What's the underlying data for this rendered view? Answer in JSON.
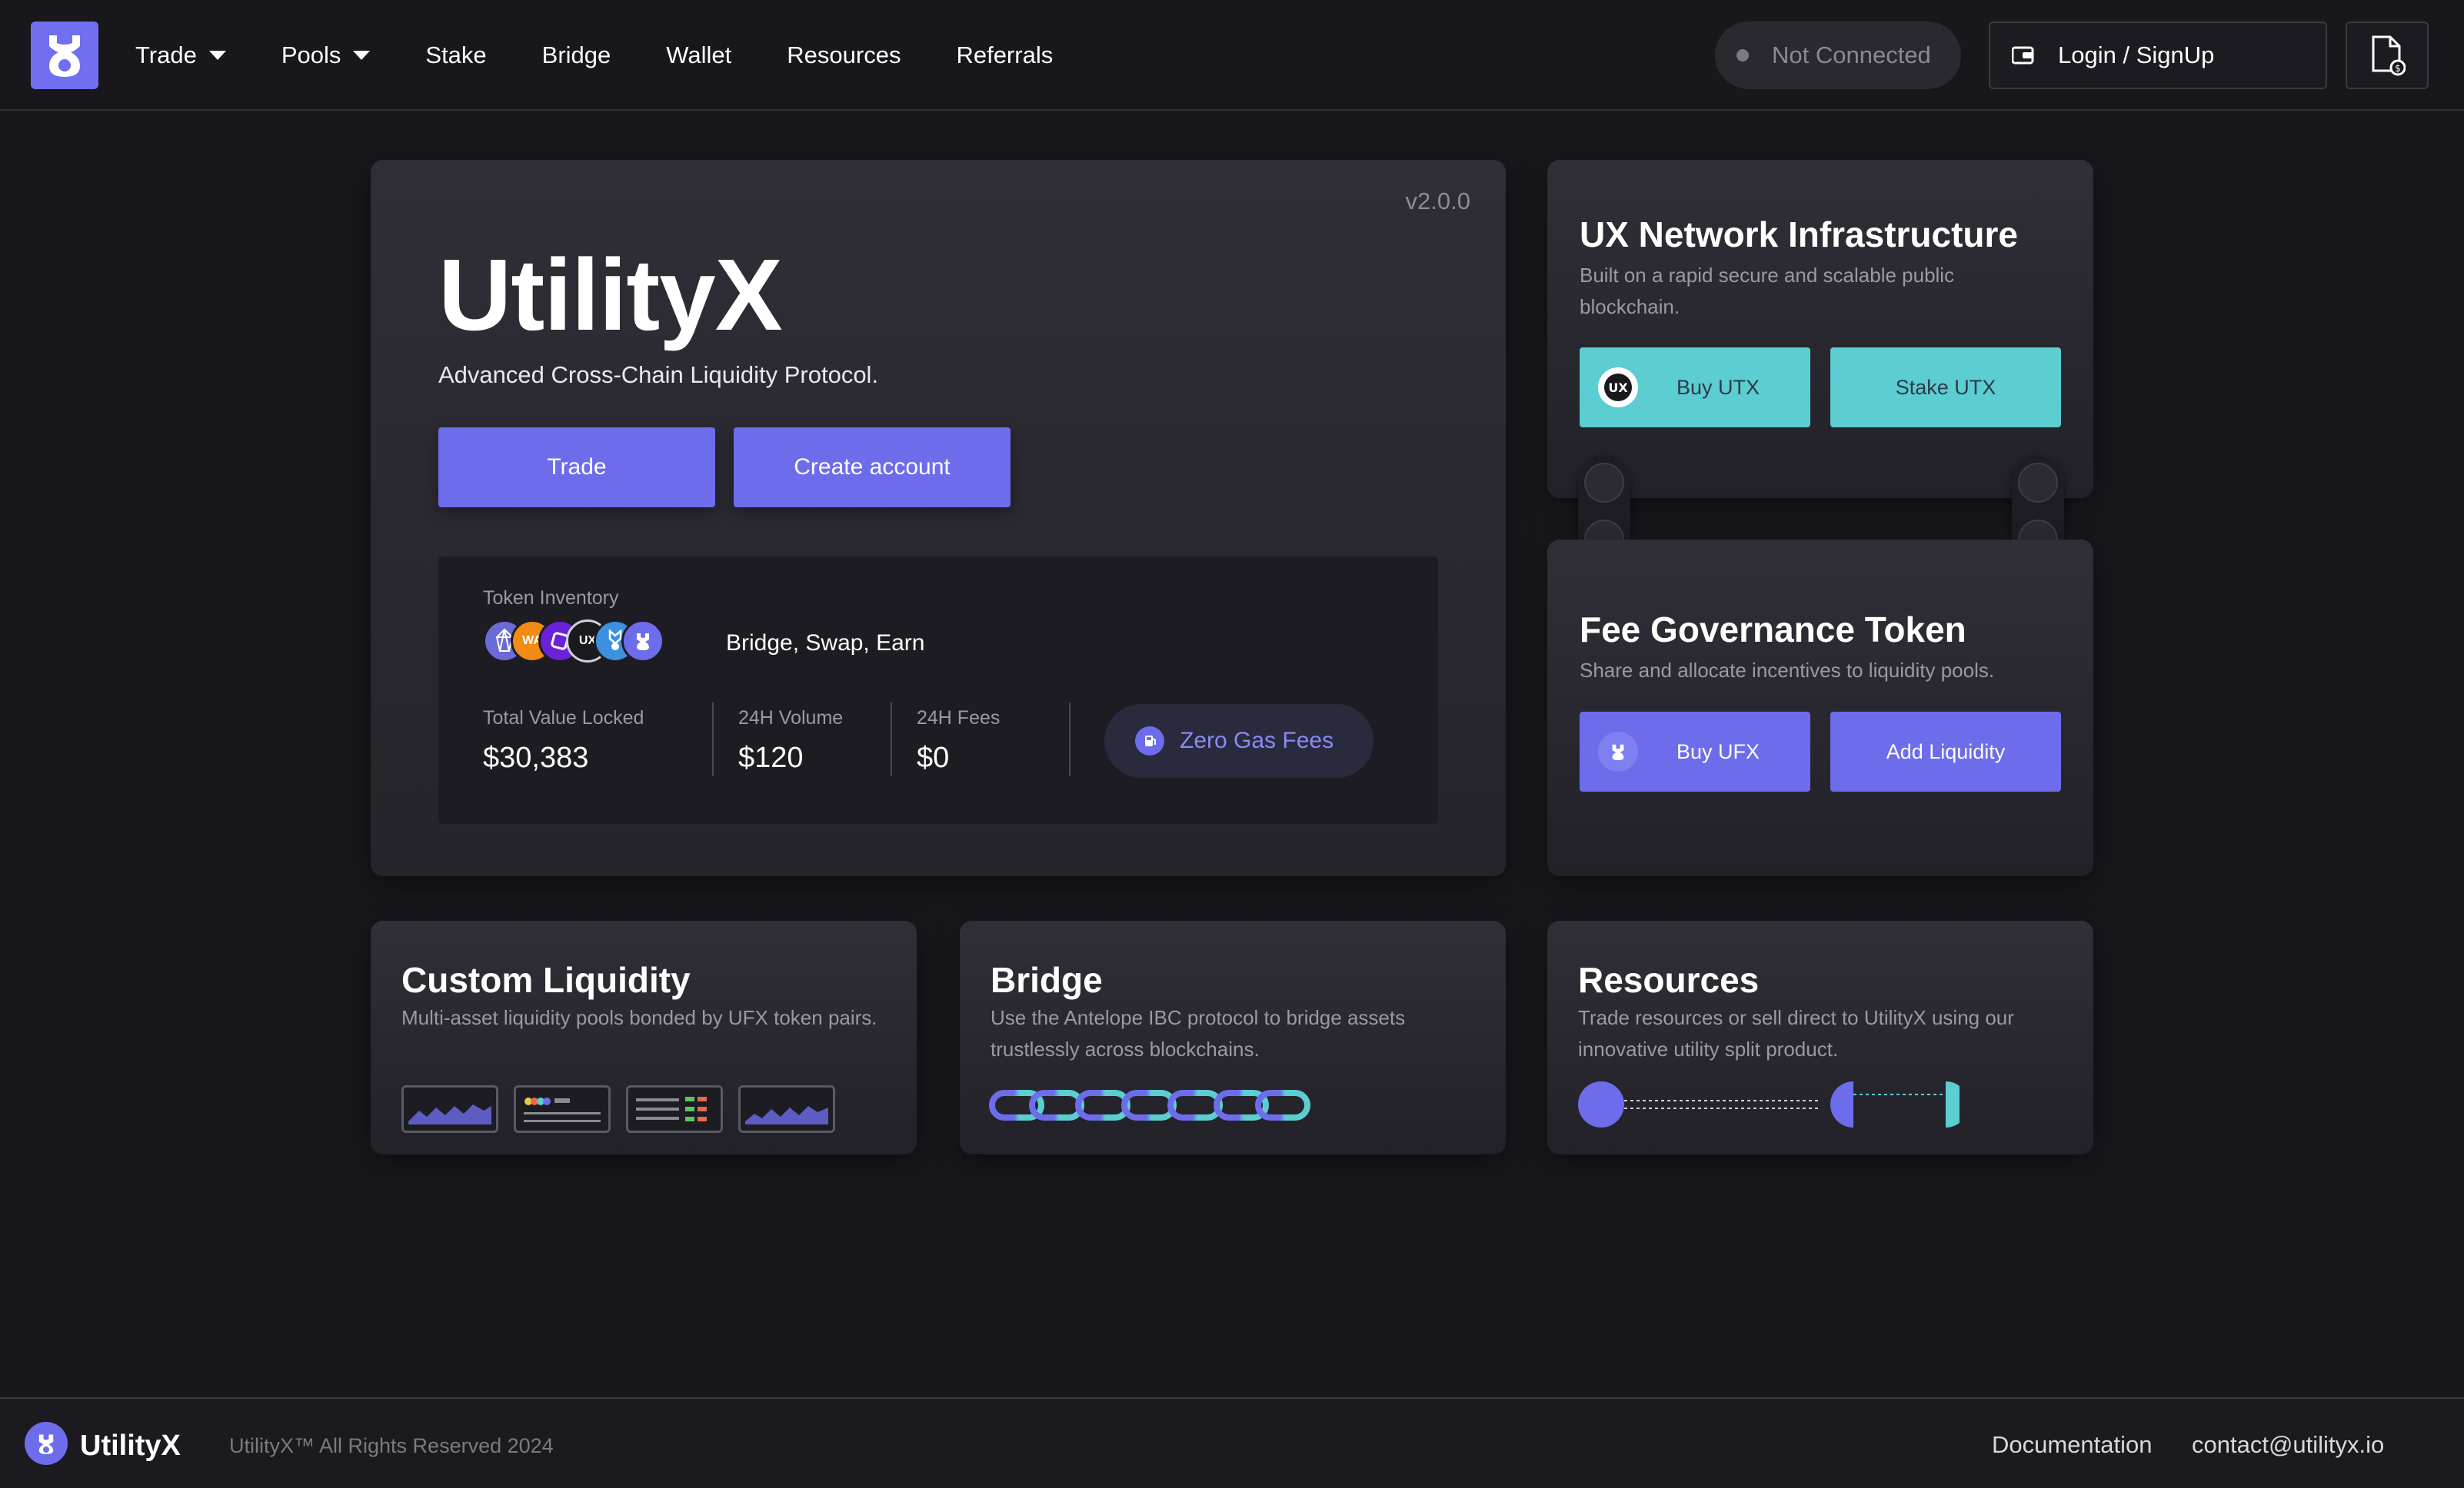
{
  "nav": {
    "items": [
      {
        "label": "Trade",
        "dropdown": true
      },
      {
        "label": "Pools",
        "dropdown": true
      },
      {
        "label": "Stake",
        "dropdown": false
      },
      {
        "label": "Bridge",
        "dropdown": false
      },
      {
        "label": "Wallet",
        "dropdown": false
      },
      {
        "label": "Resources",
        "dropdown": false
      },
      {
        "label": "Referrals",
        "dropdown": false
      }
    ],
    "status": "Not Connected",
    "login": "Login / SignUp"
  },
  "hero": {
    "version": "v2.0.0",
    "title": "UtilityX",
    "subtitle": "Advanced Cross-Chain Liquidity Protocol.",
    "trade_button": "Trade",
    "create_button": "Create account",
    "inventory_label": "Token Inventory",
    "inventory_tag": "Bridge, Swap, Earn",
    "stats": [
      {
        "label": "Total Value Locked",
        "value": "$30,383"
      },
      {
        "label": "24H Volume",
        "value": "$120"
      },
      {
        "label": "24H Fees",
        "value": "$0"
      }
    ],
    "gas_label": "Zero Gas Fees"
  },
  "network": {
    "title": "UX Network Infrastructure",
    "desc": "Built on a rapid secure and scalable public blockchain.",
    "buy_button": "Buy UTX",
    "stake_button": "Stake UTX"
  },
  "governance": {
    "title": "Fee Governance Token",
    "desc": "Share and allocate incentives to liquidity pools.",
    "buy_button": "Buy UFX",
    "liquidity_button": "Add Liquidity"
  },
  "liquidity": {
    "title": "Custom Liquidity",
    "desc": "Multi-asset liquidity pools bonded by UFX token pairs."
  },
  "bridge": {
    "title": "Bridge",
    "desc": "Use the Antelope IBC protocol to bridge assets trustlessly across blockchains."
  },
  "resources": {
    "title": "Resources",
    "desc": "Trade resources or sell direct to UtilityX using our innovative utility split product."
  },
  "footer": {
    "brand": "UtilityX",
    "copyright": "UtilityX™ All Rights Reserved 2024",
    "docs": "Documentation",
    "contact": "contact@utilityx.io"
  },
  "colors": {
    "accent": "#6d6deb",
    "teal": "#5ccdd0",
    "background": "#18171c"
  }
}
